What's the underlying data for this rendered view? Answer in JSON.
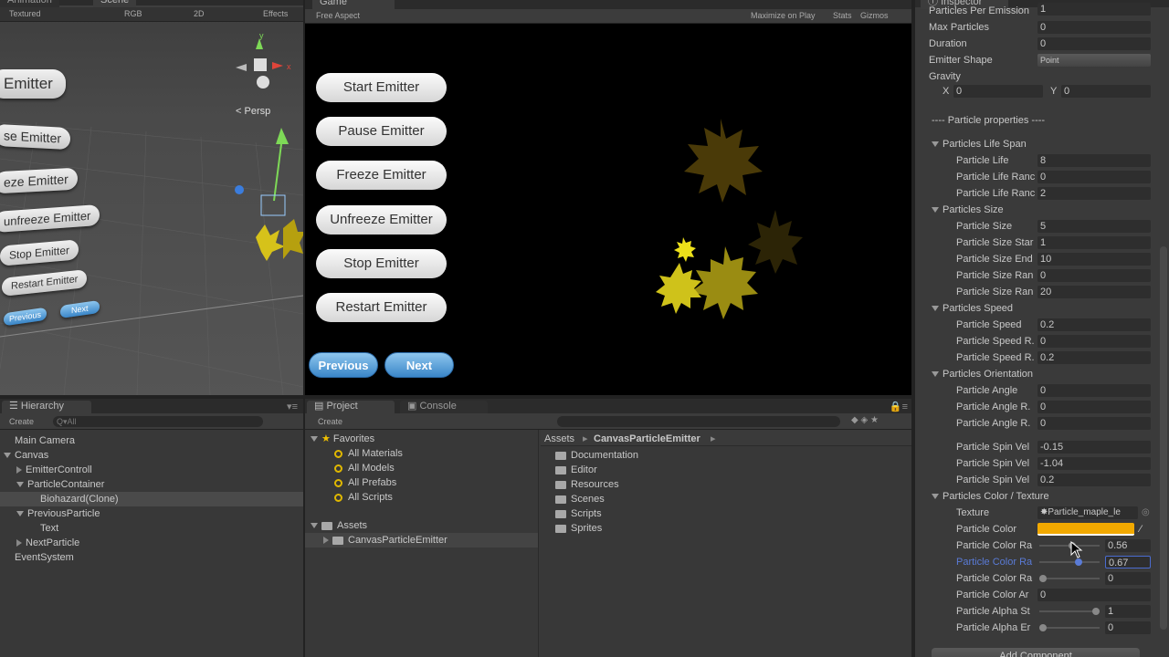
{
  "scene": {
    "tabs": {
      "animation": "Animation",
      "scene": "Scene"
    },
    "toolbar": {
      "render_mode": "Textured",
      "color_mode": "RGB",
      "mode_2d": "2D",
      "effects": "Effects"
    },
    "persp_label": "Persp",
    "gizmo_x": "x",
    "gizmo_y": "y",
    "buttons": [
      "Emitter",
      "se Emitter",
      "eze Emitter",
      "unfreeze Emitter",
      "Stop Emitter",
      "Restart Emitter"
    ],
    "nav": {
      "previous": "Previous",
      "next": "Next"
    }
  },
  "game": {
    "tab": "Game",
    "aspect": "Free Aspect",
    "maximize": "Maximize on Play",
    "stats": "Stats",
    "gizmos": "Gizmos",
    "buttons": [
      "Start Emitter",
      "Pause Emitter",
      "Freeze Emitter",
      "Unfreeze Emitter",
      "Stop Emitter",
      "Restart Emitter"
    ],
    "previous": "Previous",
    "next": "Next"
  },
  "hierarchy": {
    "tab": "Hierarchy",
    "create": "Create",
    "search_placeholder": "Q▾All",
    "items": [
      "Main Camera",
      "Canvas",
      "EmitterControll",
      "ParticleContainer",
      "Biohazard(Clone)",
      "PreviousParticle",
      "Text",
      "NextParticle",
      "EventSystem"
    ]
  },
  "project": {
    "tab": "Project",
    "console_tab": "Console",
    "create": "Create",
    "favorites": "Favorites",
    "favorite_items": [
      "All Materials",
      "All Models",
      "All Prefabs",
      "All Scripts"
    ],
    "assets": "Assets",
    "asset_items": [
      "CanvasParticleEmitter"
    ],
    "breadcrumb": [
      "Assets",
      "CanvasParticleEmitter"
    ],
    "folders": [
      "Documentation",
      "Editor",
      "Resources",
      "Scenes",
      "Scripts",
      "Sprites"
    ]
  },
  "inspector": {
    "tab": "Inspector",
    "rows": [
      {
        "label": "Particles Per Emission",
        "value": "1"
      },
      {
        "label": "Max Particles",
        "value": "0"
      },
      {
        "label": "Duration",
        "value": "0"
      },
      {
        "label": "Emitter Shape",
        "value": "Point"
      },
      {
        "label": "Gravity",
        "value": ""
      }
    ],
    "gravity": {
      "x_label": "X",
      "x": "0",
      "y_label": "Y",
      "y": "0"
    },
    "particle_properties": "---- Particle properties ----",
    "life_span": {
      "header": "Particles Life Span",
      "rows": [
        {
          "label": "Particle Life",
          "value": "8"
        },
        {
          "label": "Particle Life Ranc",
          "value": "0"
        },
        {
          "label": "Particle Life Ranc",
          "value": "2"
        }
      ]
    },
    "size": {
      "header": "Particles Size",
      "rows": [
        {
          "label": "Particle Size",
          "value": "5"
        },
        {
          "label": "Particle Size Star",
          "value": "1"
        },
        {
          "label": "Particle Size End",
          "value": "10"
        },
        {
          "label": "Particle Size Ran",
          "value": "0"
        },
        {
          "label": "Particle Size Ran",
          "value": "20"
        }
      ]
    },
    "speed": {
      "header": "Particles Speed",
      "rows": [
        {
          "label": "Particle Speed",
          "value": "0.2"
        },
        {
          "label": "Particle Speed R.",
          "value": "0"
        },
        {
          "label": "Particle Speed R.",
          "value": "0.2"
        }
      ]
    },
    "orientation": {
      "header": "Particles Orientation",
      "rows": [
        {
          "label": "Particle Angle",
          "value": "0"
        },
        {
          "label": "Particle Angle R.",
          "value": "0"
        },
        {
          "label": "Particle Angle R.",
          "value": "0"
        }
      ]
    },
    "spin": [
      {
        "label": "Particle Spin Vel",
        "value": "-0.15"
      },
      {
        "label": "Particle Spin Vel",
        "value": "-1.04"
      },
      {
        "label": "Particle Spin Vel",
        "value": "0.2"
      }
    ],
    "color_texture": {
      "header": "Particles Color / Texture",
      "texture_label": "Texture",
      "texture_value": "Particle_maple_le",
      "color_label": "Particle Color",
      "color_value": "#f2a900",
      "sliders": [
        {
          "label": "Particle Color Ra",
          "value": "0.56",
          "level": 0.56
        },
        {
          "label": "Particle Color Ra",
          "value": "0.67",
          "level": 0.67
        },
        {
          "label": "Particle Color Ra",
          "value": "0",
          "level": 0
        }
      ],
      "color_ar_label": "Particle Color Ar",
      "color_ar_value": "0",
      "alpha": [
        {
          "label": "Particle Alpha St",
          "value": "1",
          "level": 1
        },
        {
          "label": "Particle Alpha Er",
          "value": "0",
          "level": 0
        }
      ],
      "add_component": "Add Component"
    }
  }
}
